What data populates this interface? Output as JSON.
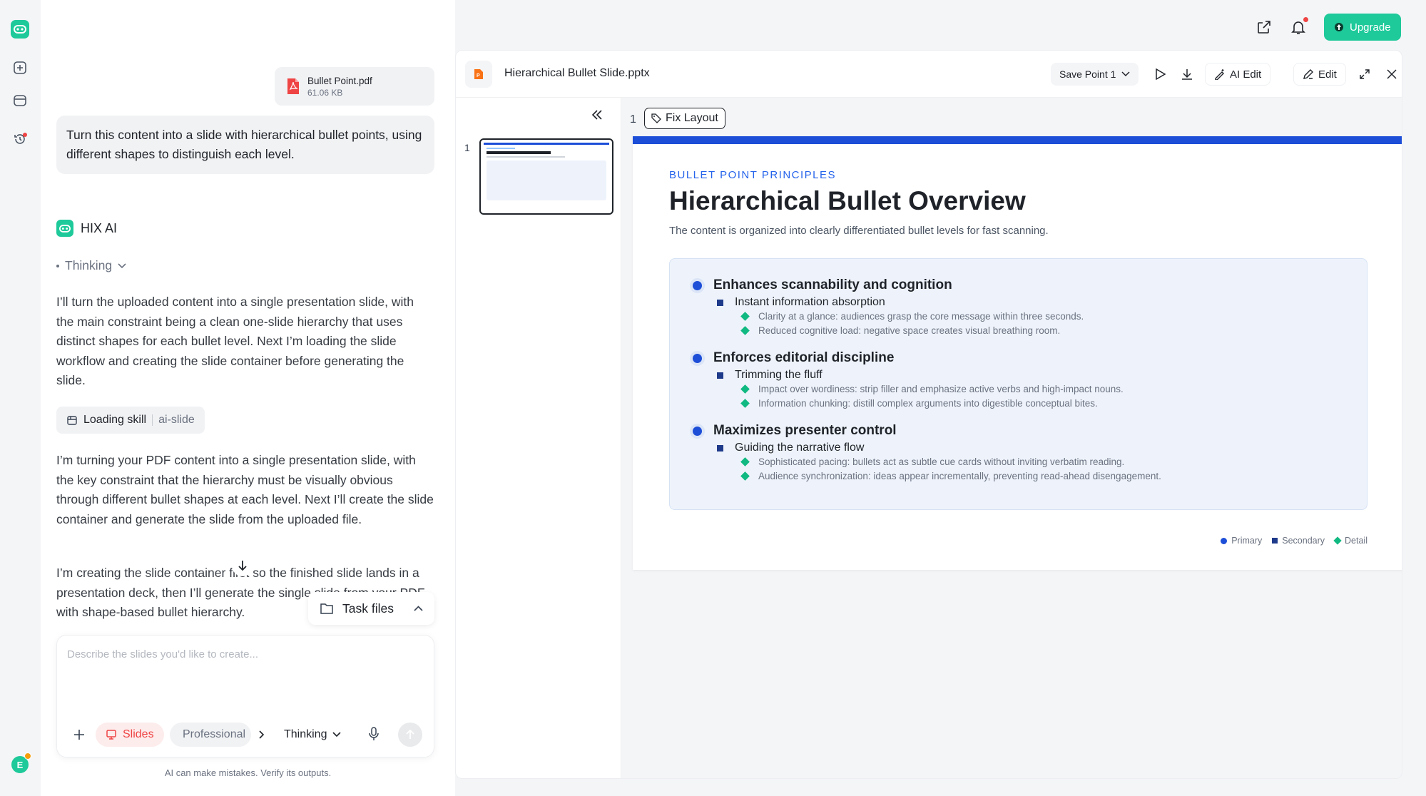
{
  "topbar": {
    "upgrade_label": "Upgrade"
  },
  "attachment": {
    "name": "Bullet Point.pdf",
    "size": "61.06 KB"
  },
  "user_message": "Turn this content into a slide with hierarchical bullet points, using different shapes to distinguish each level.",
  "assistant": {
    "name": "HIX AI",
    "thinking_label": "Thinking",
    "paragraph1": "I’ll turn the uploaded content into a single presentation slide, with the main constraint being a clean one-slide hierarchy that uses distinct shapes for each bullet level. Next I’m loading the slide workflow and creating the slide container before generating the slide.",
    "skill_label": "Loading skill",
    "skill_name": "ai-slide",
    "paragraph2": "I’m turning your PDF content into a single presentation slide, with the key constraint that the hierarchy must be visually obvious through different bullet shapes at each level. Next I’ll create the slide container and generate the slide from the uploaded file.",
    "paragraph3": "I’m creating the slide container first so the finished slide lands in a presentation deck, then I’ll generate the single slide from your PDF with shape-based bullet hierarchy."
  },
  "task_files_label": "Task files",
  "composer": {
    "placeholder": "Describe the slides you'd like to create...",
    "slides_chip": "Slides",
    "professional_chip": "Professional",
    "thinking_chip": "Thinking"
  },
  "disclaimer": "AI can make mistakes. Verify its outputs.",
  "preview": {
    "file_name": "Hierarchical Bullet Slide.pptx",
    "save_point": "Save Point 1",
    "ai_edit_label": "AI Edit",
    "edit_label": "Edit",
    "fix_layout_label": "Fix Layout",
    "slide_number": "1",
    "thumb_number": "1"
  },
  "slide": {
    "kicker": "BULLET POINT PRINCIPLES",
    "title": "Hierarchical Bullet Overview",
    "subtitle": "The content is organized into clearly differentiated bullet levels for fast scanning.",
    "groups": [
      {
        "primary": "Enhances scannability and cognition",
        "secondary": "Instant information absorption",
        "details": [
          "Clarity at a glance: audiences grasp the core message within three seconds.",
          "Reduced cognitive load: negative space creates visual breathing room."
        ]
      },
      {
        "primary": "Enforces editorial discipline",
        "secondary": "Trimming the fluff",
        "details": [
          "Impact over wordiness: strip filler and emphasize active verbs and high-impact nouns.",
          "Information chunking: distill complex arguments into digestible conceptual bites."
        ]
      },
      {
        "primary": "Maximizes presenter control",
        "secondary": "Guiding the narrative flow",
        "details": [
          "Sophisticated pacing: bullets act as subtle cue cards without inviting verbatim reading.",
          "Audience synchronization: ideas appear incrementally, preventing read-ahead disengagement."
        ]
      }
    ],
    "legend": {
      "primary": "Primary",
      "secondary": "Secondary",
      "detail": "Detail"
    }
  },
  "colors": {
    "accent": "#1d4ed8",
    "brand": "#1ec99a",
    "detail": "#10b981",
    "navy": "#1e3a8a"
  }
}
